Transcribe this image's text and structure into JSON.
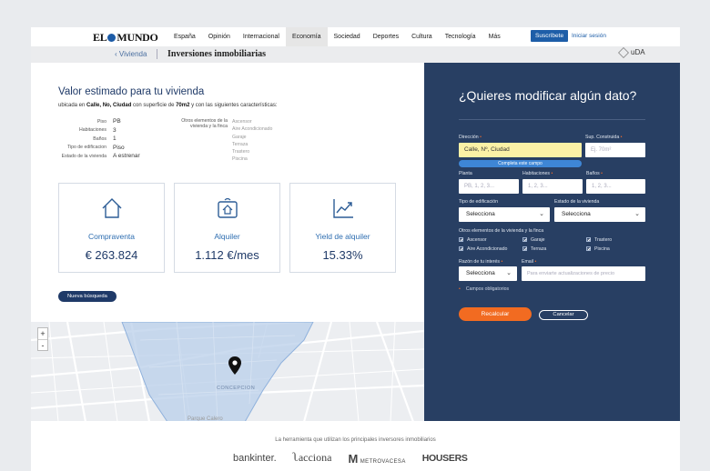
{
  "topnav": {
    "logo": "EL MUNDO",
    "items": [
      "España",
      "Opinión",
      "Internacional",
      "Economía",
      "Sociedad",
      "Deportes",
      "Cultura",
      "Tecnología",
      "Más"
    ],
    "active": "Economía",
    "subscribe": "Suscríbete",
    "login": "Iniciar sesión"
  },
  "subnav": {
    "breadcrumb": "‹ Vivienda",
    "title": "Inversiones inmobiliarias",
    "partner_logo": "uDA"
  },
  "estimate": {
    "title": "Valor estimado para tu vivienda",
    "subtitle_prefix": "ubicada en",
    "address": "Calle, No, Ciudad",
    "subtitle_mid": "con superficie de",
    "surface": "70m2",
    "subtitle_suffix": "y con las siguientes características:",
    "properties": [
      {
        "label": "Piso",
        "value": "PB"
      },
      {
        "label": "Habitaciones",
        "value": "3"
      },
      {
        "label": "Baños",
        "value": "1"
      },
      {
        "label": "Tipo de edificacion",
        "value": "Piso"
      },
      {
        "label": "Estado de la vivienda",
        "value": "A estrenar"
      }
    ],
    "others_label": "Otros elementos de la vivienda y la finca",
    "others": [
      "Ascensor",
      "Aire Acondicionado",
      "Garaje",
      "Terraza",
      "Trastero",
      "Piscina"
    ]
  },
  "cards": [
    {
      "icon": "house-icon",
      "title": "Compraventa",
      "value": "€ 263.824"
    },
    {
      "icon": "house-tag-icon",
      "title": "Alquiler",
      "value": "1.112 €/mes"
    },
    {
      "icon": "chart-trend-icon",
      "title": "Yield de alquiler",
      "value": "15.33%"
    }
  ],
  "new_search": "Nueva búsqueda",
  "map": {
    "zoom_in": "+",
    "zoom_out": "-",
    "area_label": "CONCEPCION",
    "park_label": "Parque Calero"
  },
  "form": {
    "title": "¿Quieres modificar algún dato?",
    "direccion_label": "Dirección",
    "direccion_value": "Calle, Nº, Ciudad",
    "direccion_hint": "Completa este campo",
    "superficie_label": "Sup. Construida",
    "superficie_placeholder": "Ej. 70m²",
    "planta_label": "Planta",
    "planta_placeholder": "PB, 1, 2, 3...",
    "habitaciones_label": "Habitaciones",
    "habitaciones_placeholder": "1, 2, 3...",
    "banos_label": "Baños",
    "banos_placeholder": "1, 2, 3...",
    "tipo_label": "Tipo de edificación",
    "tipo_value": "Selecciona",
    "estado_label": "Estado de la vivienda",
    "estado_value": "Selecciona",
    "otros_label": "Otros elementos de la vivienda y la finca",
    "checkboxes": [
      "Ascensor",
      "Garaje",
      "Trastero",
      "Aire Acondicionado",
      "Terraza",
      "Piscina"
    ],
    "razon_label": "Razón de tu interés",
    "razon_value": "Selecciona",
    "email_label": "Email",
    "email_placeholder": "Para enviarte actualizaciones de precio",
    "required_note": "Campos obligatorios",
    "recalcular": "Recalcular",
    "cancelar": "Cancelar"
  },
  "footer": {
    "text": "La herramienta que utilizan los principales inversores inmobiliarios",
    "brands": [
      "bankinter.",
      "acciona",
      "METROVACESA",
      "HOUSERS"
    ]
  },
  "colors": {
    "navy": "#283f63",
    "accent_orange": "#f26b21",
    "link_blue": "#2d6db0",
    "highlight_yellow": "#fbf1a6"
  }
}
